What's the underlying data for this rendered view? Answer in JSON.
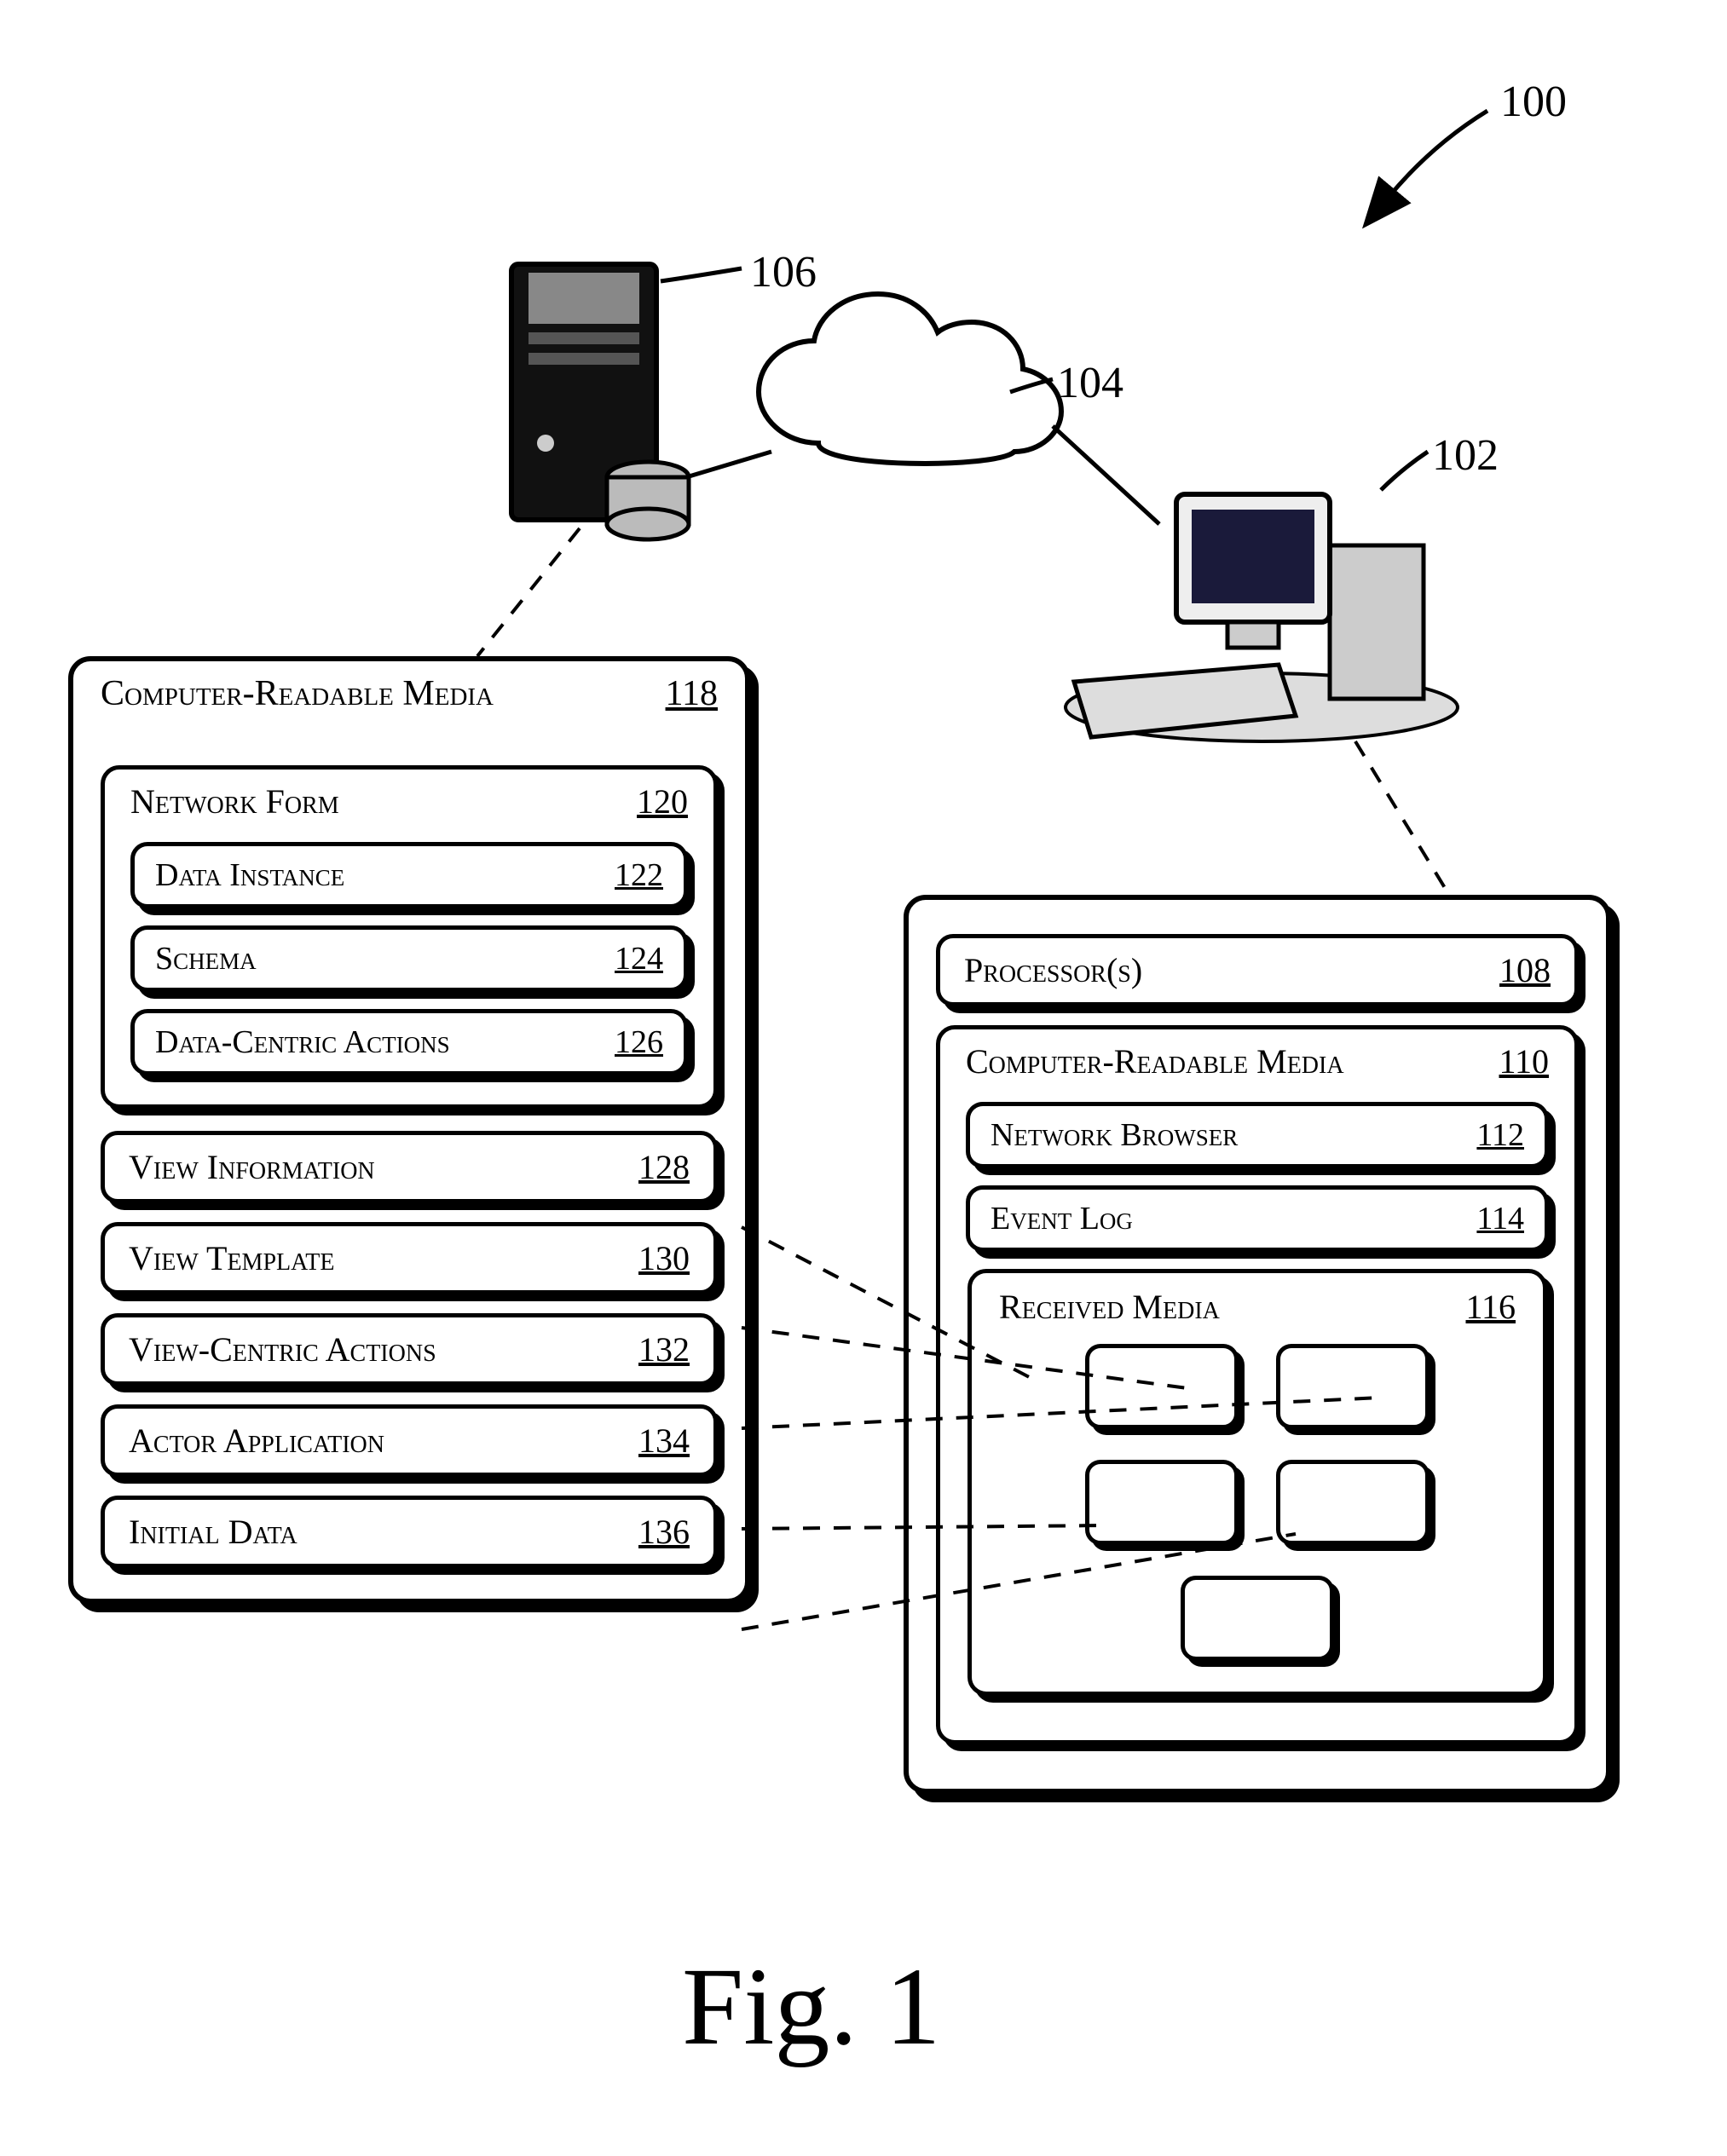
{
  "figure": {
    "label": "Fig. 1",
    "ref_100": "100"
  },
  "server_media": {
    "title": "Computer-Readable Media",
    "num": "118",
    "network_form": {
      "title": "Network Form",
      "num": "120",
      "data_instance": {
        "label": "Data Instance",
        "num": "122"
      },
      "schema": {
        "label": "Schema",
        "num": "124"
      },
      "dc_actions": {
        "label": "Data-Centric Actions",
        "num": "126"
      }
    },
    "view_info": {
      "label": "View Information",
      "num": "128"
    },
    "view_template": {
      "label": "View Template",
      "num": "130"
    },
    "vc_actions": {
      "label": "View-Centric Actions",
      "num": "132"
    },
    "actor_app": {
      "label": "Actor Application",
      "num": "134"
    },
    "initial_data": {
      "label": "Initial Data",
      "num": "136"
    }
  },
  "client": {
    "processors": {
      "label": "Processor(s)",
      "num": "108"
    },
    "media": {
      "title": "Computer-Readable Media",
      "num": "110",
      "browser": {
        "label": "Network Browser",
        "num": "112"
      },
      "event_log": {
        "label": "Event Log",
        "num": "114"
      },
      "received": {
        "label": "Received Media",
        "num": "116"
      }
    }
  },
  "refs": {
    "client_pc": "102",
    "cloud": "104",
    "server": "106"
  }
}
